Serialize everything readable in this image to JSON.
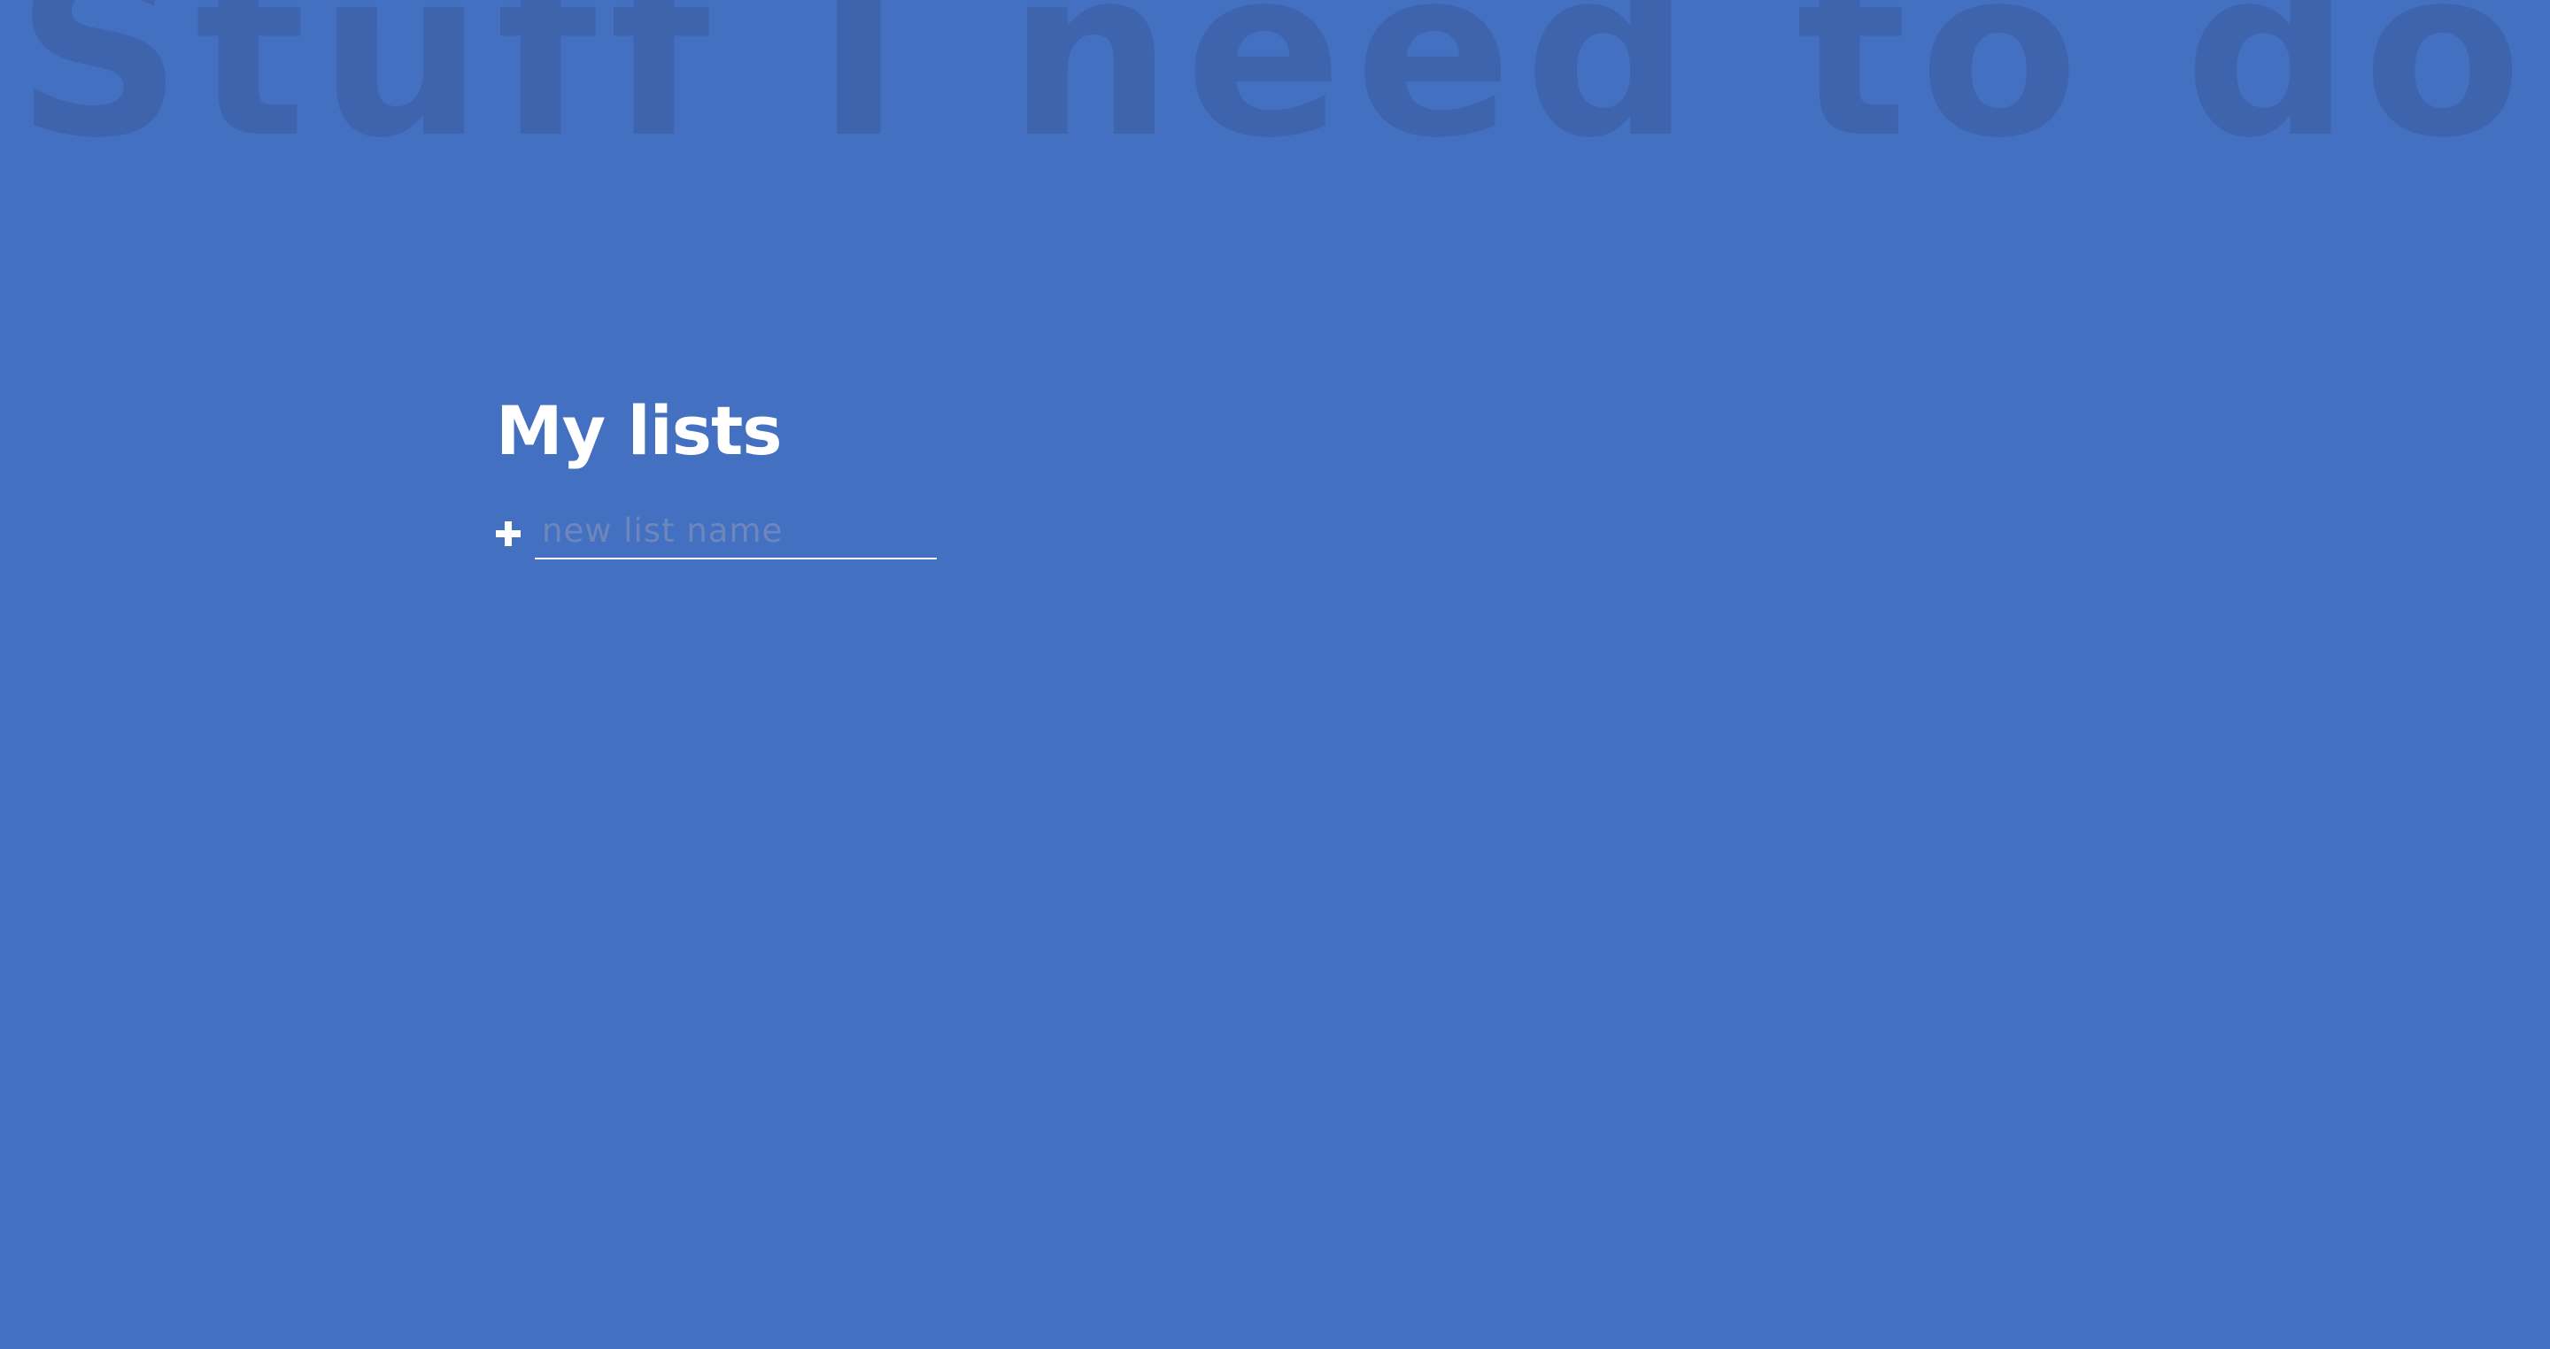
{
  "app": {
    "title": "Stuff I need to do"
  },
  "main": {
    "section_title": "My lists",
    "new_list": {
      "value": "",
      "placeholder": "new list name",
      "icon": "plus-icon"
    }
  },
  "colors": {
    "background": "#4470c1",
    "title_watermark": "#3e64ae",
    "text": "#ffffff",
    "placeholder": "#6d87bc"
  }
}
